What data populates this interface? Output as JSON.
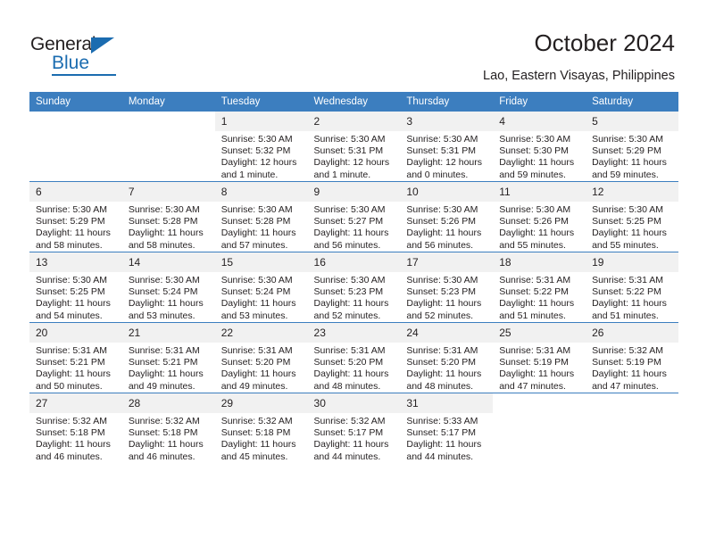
{
  "brand": {
    "name_dark": "General",
    "name_blue": "Blue",
    "accent_color": "#1b6cb0"
  },
  "header": {
    "title": "October 2024",
    "subtitle": "Lao, Eastern Visayas, Philippines",
    "header_bg_color": "#3c7ebf",
    "daynum_bg_color": "#f1f1f1"
  },
  "calendar": {
    "weekday_headers": [
      "Sunday",
      "Monday",
      "Tuesday",
      "Wednesday",
      "Thursday",
      "Friday",
      "Saturday"
    ],
    "labels": {
      "sunrise": "Sunrise:",
      "sunset": "Sunset:",
      "daylight": "Daylight:"
    },
    "weeks": [
      [
        {
          "day": "",
          "blank": true
        },
        {
          "day": "",
          "blank": true
        },
        {
          "day": "1",
          "sunrise": "Sunrise: 5:30 AM",
          "sunset": "Sunset: 5:32 PM",
          "daylight": "Daylight: 12 hours and 1 minute."
        },
        {
          "day": "2",
          "sunrise": "Sunrise: 5:30 AM",
          "sunset": "Sunset: 5:31 PM",
          "daylight": "Daylight: 12 hours and 1 minute."
        },
        {
          "day": "3",
          "sunrise": "Sunrise: 5:30 AM",
          "sunset": "Sunset: 5:31 PM",
          "daylight": "Daylight: 12 hours and 0 minutes."
        },
        {
          "day": "4",
          "sunrise": "Sunrise: 5:30 AM",
          "sunset": "Sunset: 5:30 PM",
          "daylight": "Daylight: 11 hours and 59 minutes."
        },
        {
          "day": "5",
          "sunrise": "Sunrise: 5:30 AM",
          "sunset": "Sunset: 5:29 PM",
          "daylight": "Daylight: 11 hours and 59 minutes."
        }
      ],
      [
        {
          "day": "6",
          "sunrise": "Sunrise: 5:30 AM",
          "sunset": "Sunset: 5:29 PM",
          "daylight": "Daylight: 11 hours and 58 minutes."
        },
        {
          "day": "7",
          "sunrise": "Sunrise: 5:30 AM",
          "sunset": "Sunset: 5:28 PM",
          "daylight": "Daylight: 11 hours and 58 minutes."
        },
        {
          "day": "8",
          "sunrise": "Sunrise: 5:30 AM",
          "sunset": "Sunset: 5:28 PM",
          "daylight": "Daylight: 11 hours and 57 minutes."
        },
        {
          "day": "9",
          "sunrise": "Sunrise: 5:30 AM",
          "sunset": "Sunset: 5:27 PM",
          "daylight": "Daylight: 11 hours and 56 minutes."
        },
        {
          "day": "10",
          "sunrise": "Sunrise: 5:30 AM",
          "sunset": "Sunset: 5:26 PM",
          "daylight": "Daylight: 11 hours and 56 minutes."
        },
        {
          "day": "11",
          "sunrise": "Sunrise: 5:30 AM",
          "sunset": "Sunset: 5:26 PM",
          "daylight": "Daylight: 11 hours and 55 minutes."
        },
        {
          "day": "12",
          "sunrise": "Sunrise: 5:30 AM",
          "sunset": "Sunset: 5:25 PM",
          "daylight": "Daylight: 11 hours and 55 minutes."
        }
      ],
      [
        {
          "day": "13",
          "sunrise": "Sunrise: 5:30 AM",
          "sunset": "Sunset: 5:25 PM",
          "daylight": "Daylight: 11 hours and 54 minutes."
        },
        {
          "day": "14",
          "sunrise": "Sunrise: 5:30 AM",
          "sunset": "Sunset: 5:24 PM",
          "daylight": "Daylight: 11 hours and 53 minutes."
        },
        {
          "day": "15",
          "sunrise": "Sunrise: 5:30 AM",
          "sunset": "Sunset: 5:24 PM",
          "daylight": "Daylight: 11 hours and 53 minutes."
        },
        {
          "day": "16",
          "sunrise": "Sunrise: 5:30 AM",
          "sunset": "Sunset: 5:23 PM",
          "daylight": "Daylight: 11 hours and 52 minutes."
        },
        {
          "day": "17",
          "sunrise": "Sunrise: 5:30 AM",
          "sunset": "Sunset: 5:23 PM",
          "daylight": "Daylight: 11 hours and 52 minutes."
        },
        {
          "day": "18",
          "sunrise": "Sunrise: 5:31 AM",
          "sunset": "Sunset: 5:22 PM",
          "daylight": "Daylight: 11 hours and 51 minutes."
        },
        {
          "day": "19",
          "sunrise": "Sunrise: 5:31 AM",
          "sunset": "Sunset: 5:22 PM",
          "daylight": "Daylight: 11 hours and 51 minutes."
        }
      ],
      [
        {
          "day": "20",
          "sunrise": "Sunrise: 5:31 AM",
          "sunset": "Sunset: 5:21 PM",
          "daylight": "Daylight: 11 hours and 50 minutes."
        },
        {
          "day": "21",
          "sunrise": "Sunrise: 5:31 AM",
          "sunset": "Sunset: 5:21 PM",
          "daylight": "Daylight: 11 hours and 49 minutes."
        },
        {
          "day": "22",
          "sunrise": "Sunrise: 5:31 AM",
          "sunset": "Sunset: 5:20 PM",
          "daylight": "Daylight: 11 hours and 49 minutes."
        },
        {
          "day": "23",
          "sunrise": "Sunrise: 5:31 AM",
          "sunset": "Sunset: 5:20 PM",
          "daylight": "Daylight: 11 hours and 48 minutes."
        },
        {
          "day": "24",
          "sunrise": "Sunrise: 5:31 AM",
          "sunset": "Sunset: 5:20 PM",
          "daylight": "Daylight: 11 hours and 48 minutes."
        },
        {
          "day": "25",
          "sunrise": "Sunrise: 5:31 AM",
          "sunset": "Sunset: 5:19 PM",
          "daylight": "Daylight: 11 hours and 47 minutes."
        },
        {
          "day": "26",
          "sunrise": "Sunrise: 5:32 AM",
          "sunset": "Sunset: 5:19 PM",
          "daylight": "Daylight: 11 hours and 47 minutes."
        }
      ],
      [
        {
          "day": "27",
          "sunrise": "Sunrise: 5:32 AM",
          "sunset": "Sunset: 5:18 PM",
          "daylight": "Daylight: 11 hours and 46 minutes."
        },
        {
          "day": "28",
          "sunrise": "Sunrise: 5:32 AM",
          "sunset": "Sunset: 5:18 PM",
          "daylight": "Daylight: 11 hours and 46 minutes."
        },
        {
          "day": "29",
          "sunrise": "Sunrise: 5:32 AM",
          "sunset": "Sunset: 5:18 PM",
          "daylight": "Daylight: 11 hours and 45 minutes."
        },
        {
          "day": "30",
          "sunrise": "Sunrise: 5:32 AM",
          "sunset": "Sunset: 5:17 PM",
          "daylight": "Daylight: 11 hours and 44 minutes."
        },
        {
          "day": "31",
          "sunrise": "Sunrise: 5:33 AM",
          "sunset": "Sunset: 5:17 PM",
          "daylight": "Daylight: 11 hours and 44 minutes."
        },
        {
          "day": "",
          "blank": true
        },
        {
          "day": "",
          "blank": true
        }
      ]
    ]
  }
}
